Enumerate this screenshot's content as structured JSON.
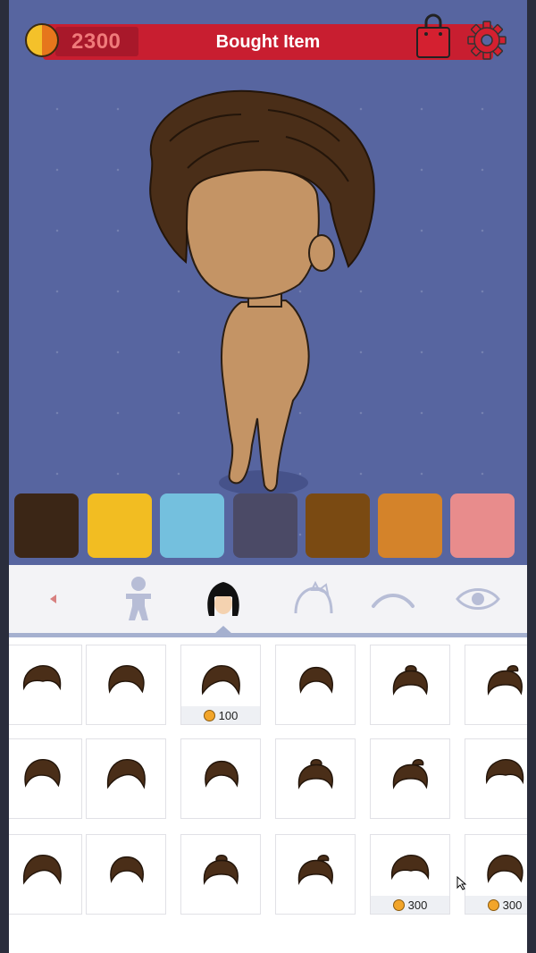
{
  "header": {
    "coins": "2300",
    "title": "Bought Item"
  },
  "icons": {
    "coin": "coin-icon",
    "bag": "shopping-bag-icon",
    "settings": "gear-icon"
  },
  "colors": {
    "header_bg": "#c81e30",
    "stage_bg": "#5765a0",
    "tab_underline": "#a5b0cf"
  },
  "swatches": [
    "#3b2616",
    "#f2bd22",
    "#74c0de",
    "#4b4a66",
    "#7a4a12",
    "#d4832a",
    "#e88c8c"
  ],
  "category_tabs": [
    {
      "name": "tab-arrow-left",
      "icon": "arrow-left-icon",
      "active": false
    },
    {
      "name": "tab-body",
      "icon": "body-icon",
      "active": false
    },
    {
      "name": "tab-hair",
      "icon": "hair-icon",
      "active": true
    },
    {
      "name": "tab-accessory",
      "icon": "headband-icon",
      "active": false
    },
    {
      "name": "tab-eyebrow",
      "icon": "eyebrow-icon",
      "active": false
    },
    {
      "name": "tab-eyes",
      "icon": "eye-icon",
      "active": false
    }
  ],
  "hair_items": [
    {
      "price": ""
    },
    {
      "price": ""
    },
    {
      "price": "100"
    },
    {
      "price": ""
    },
    {
      "price": ""
    },
    {
      "price": ""
    },
    {
      "price": ""
    },
    {
      "price": ""
    },
    {
      "price": ""
    },
    {
      "price": ""
    },
    {
      "price": ""
    },
    {
      "price": ""
    },
    {
      "price": ""
    },
    {
      "price": ""
    },
    {
      "price": ""
    },
    {
      "price": ""
    },
    {
      "price": "300"
    },
    {
      "price": "300"
    }
  ]
}
